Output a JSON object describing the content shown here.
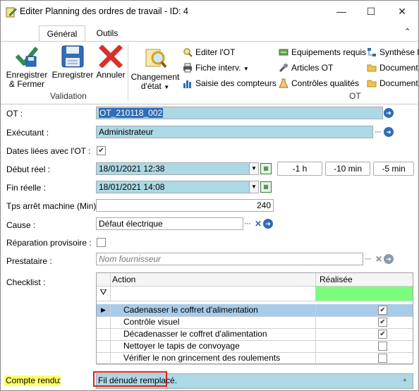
{
  "window": {
    "title": "Editer Planning des ordres de travail - ID: 4",
    "minimize": "—",
    "maximize": "☐",
    "close": "✕"
  },
  "ribbon": {
    "tabs": [
      {
        "label": "Général"
      },
      {
        "label": "Outils"
      }
    ],
    "collapse_glyph": "⌃",
    "validation": {
      "group_label": "Validation",
      "save_close_l1": "Enregistrer",
      "save_close_l2": "& Fermer",
      "save": "Enregistrer",
      "cancel": "Annuler"
    },
    "ot": {
      "group_label": "OT",
      "change_state_l1": "Changement",
      "change_state_l2": "d'état",
      "edit_ot": "Editer l'OT",
      "fiche_interv": "Fiche interv.",
      "saisie_compteurs": "Saisie des compteurs",
      "equipements_requis": "Equipements requis",
      "articles_ot": "Articles OT",
      "controles_qualites": "Contrôles qualités",
      "synthese": "Synthèse l",
      "document1": "Document",
      "document2": "Document"
    }
  },
  "form": {
    "ot": {
      "label": "OT :",
      "value": "OT_210118_002"
    },
    "executant": {
      "label": "Exécutant :",
      "value": "Administrateur"
    },
    "dates_liees": {
      "label": "Dates liées avec l'OT :",
      "checked": true
    },
    "debut_reel": {
      "label": "Début réel :",
      "value": "18/01/2021 12:38"
    },
    "fin_reelle": {
      "label": "Fin réelle :",
      "value": "18/01/2021 14:08"
    },
    "time_buttons": {
      "minus1h": "-1 h",
      "minus10": "-10 min",
      "minus5": "-5 min"
    },
    "tps_arret": {
      "label": "Tps arrêt machine (Min) :",
      "value": "240"
    },
    "cause": {
      "label": "Cause :",
      "value": "Défaut électrique"
    },
    "reparation_provisoire": {
      "label": "Réparation provisoire :",
      "checked": false
    },
    "prestataire": {
      "label": "Prestataire :",
      "placeholder": "Nom fournisseur"
    },
    "checklist": {
      "label": "Checklist :",
      "col_action": "Action",
      "col_realisee": "Réalisée",
      "rows": [
        {
          "action": "Cadenasser le coffret d'alimentation",
          "done": true
        },
        {
          "action": "Contrôle visuel",
          "done": true
        },
        {
          "action": "Décadenasser le coffret d'alimentation",
          "done": true
        },
        {
          "action": "Nettoyer le tapis de convoyage",
          "done": false
        },
        {
          "action": "Vérifier le non grincement des roulements",
          "done": false
        }
      ]
    },
    "compte_rendu": {
      "label": "Compte rendu",
      "colon": ":",
      "value": "Fil dénudé remplacé."
    }
  },
  "colors": {
    "field_blue": "#add8e6",
    "filter_green": "#7cfc7c",
    "selected_row": "#a8cbe9",
    "highlight_yellow": "#ffff66",
    "annotation_red": "#e0201b"
  }
}
